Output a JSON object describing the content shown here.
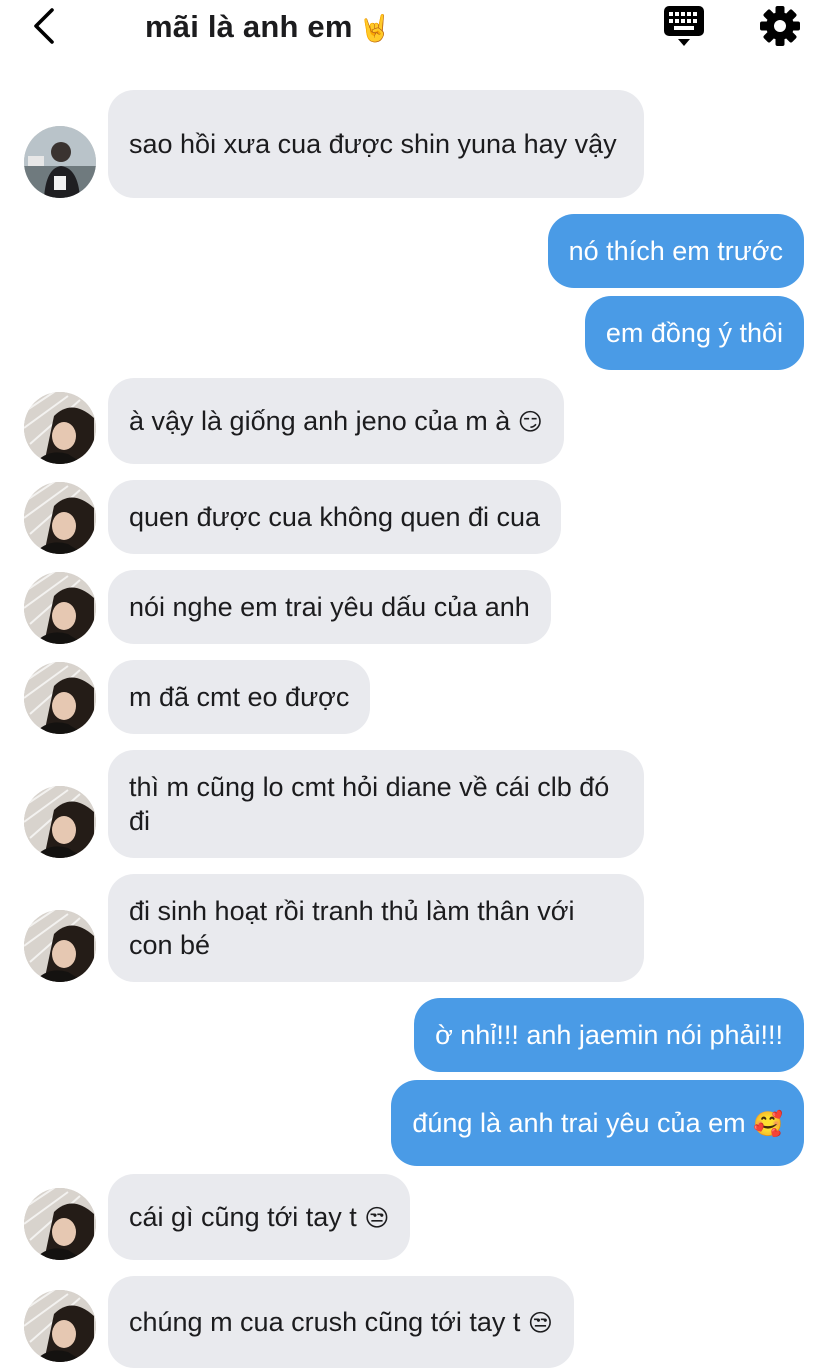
{
  "header": {
    "title": "mãi là anh em",
    "title_emoji": "🤘",
    "back_icon": "chevron-left-icon",
    "keyboard_icon": "keyboard-icon",
    "settings_icon": "gear-icon"
  },
  "colors": {
    "outgoing_bubble": "#4a9be6",
    "incoming_bubble": "#e9eaee",
    "outgoing_text": "#ffffff",
    "incoming_text": "#1c1c1e"
  },
  "messages": [
    {
      "direction": "in",
      "text": "sao hồi xưa cua được shin yuna hay vậy",
      "emoji": ""
    },
    {
      "direction": "out",
      "text": "nó thích em trước",
      "emoji": ""
    },
    {
      "direction": "out",
      "text": "em đồng ý thôi",
      "emoji": ""
    },
    {
      "direction": "in",
      "text": "à vậy là giống anh jeno của m à",
      "emoji": "😏"
    },
    {
      "direction": "in",
      "text": "quen được cua không quen đi cua",
      "emoji": ""
    },
    {
      "direction": "in",
      "text": "nói nghe em trai yêu dấu của anh",
      "emoji": ""
    },
    {
      "direction": "in",
      "text": "m đã cmt eo được",
      "emoji": ""
    },
    {
      "direction": "in",
      "text": "thì m cũng lo cmt hỏi diane về cái clb đó đi",
      "emoji": ""
    },
    {
      "direction": "in",
      "text": "đi sinh hoạt rồi tranh thủ làm thân với con bé",
      "emoji": ""
    },
    {
      "direction": "out",
      "text": "ờ nhỉ!!! anh jaemin nói phải!!!",
      "emoji": ""
    },
    {
      "direction": "out",
      "text": "đúng là anh trai yêu của em",
      "emoji": "🥰"
    },
    {
      "direction": "in",
      "text": "cái gì cũng tới tay t",
      "emoji": "😒"
    },
    {
      "direction": "in",
      "text": "chúng m cua crush cũng tới tay t",
      "emoji": "😒"
    }
  ]
}
